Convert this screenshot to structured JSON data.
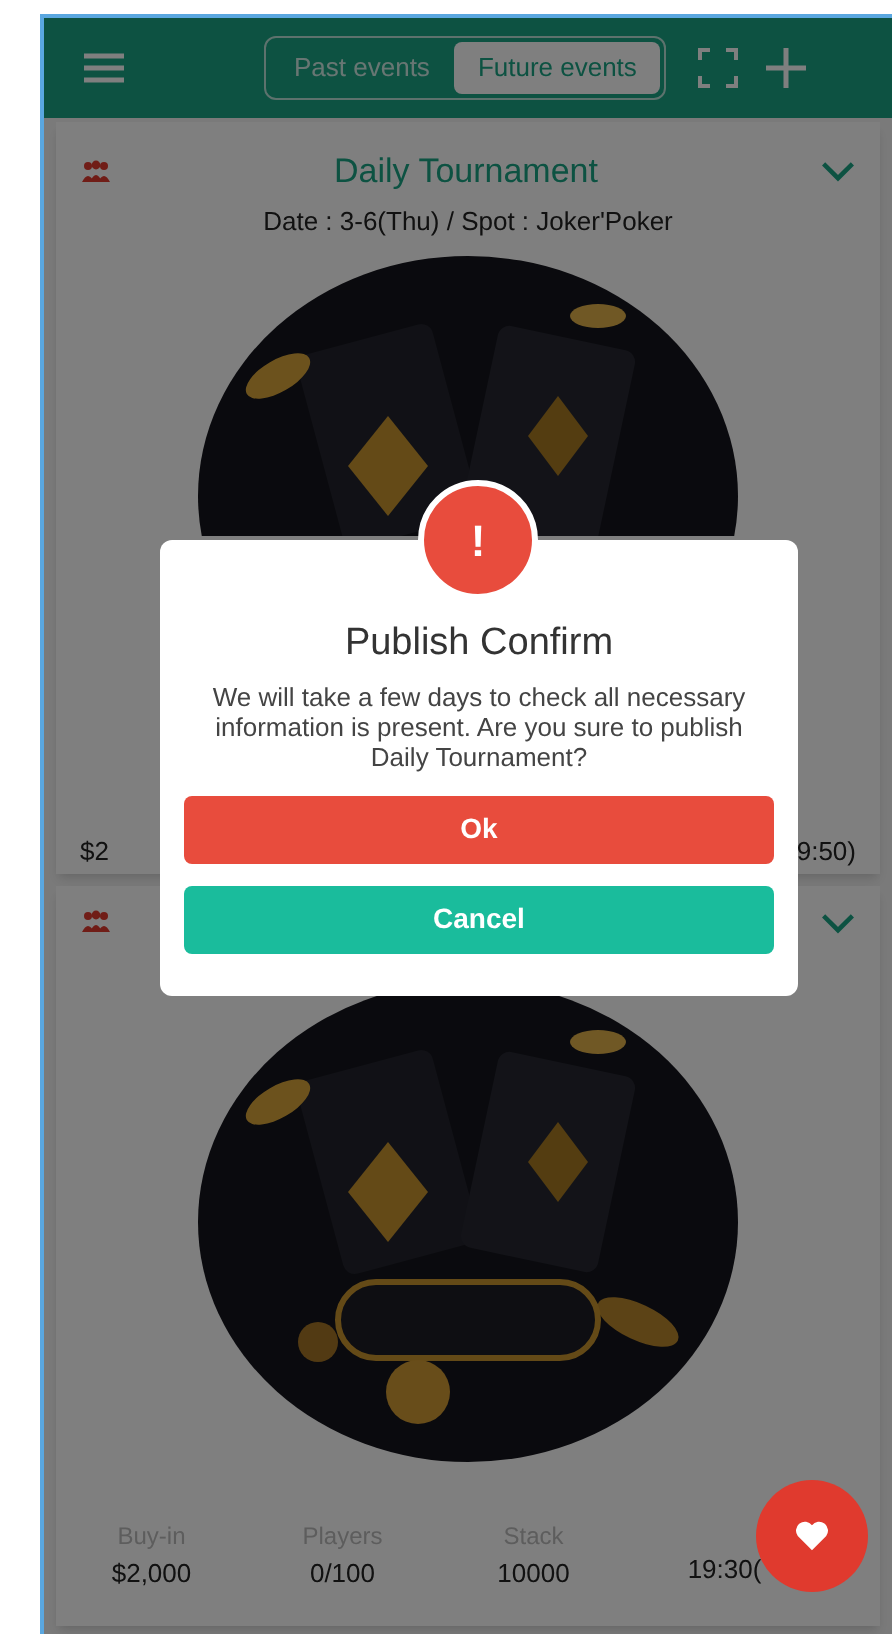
{
  "header": {
    "tabs": [
      {
        "label": "Past events",
        "selected": false
      },
      {
        "label": "Future events",
        "selected": true
      }
    ]
  },
  "cards": [
    {
      "title": "Daily Tournament",
      "subtitle": "Date : 3-6(Thu) / Spot : Joker'Poker",
      "stats_fragments": [
        "$2",
        "9:50)"
      ]
    },
    {
      "stats": [
        {
          "label": "Buy-in",
          "value": "$2,000"
        },
        {
          "label": "Players",
          "value": "0/100"
        },
        {
          "label": "Stack",
          "value": "10000"
        },
        {
          "value": "19:30("
        }
      ]
    }
  ],
  "dialog": {
    "icon_text": "!",
    "title": "Publish Confirm",
    "message": "We will take a few days to check all necessary information is present. Are you sure to publish Daily Tournament?",
    "buttons": [
      {
        "label": "Ok",
        "kind": "danger"
      },
      {
        "label": "Cancel",
        "kind": "confirm"
      }
    ]
  }
}
